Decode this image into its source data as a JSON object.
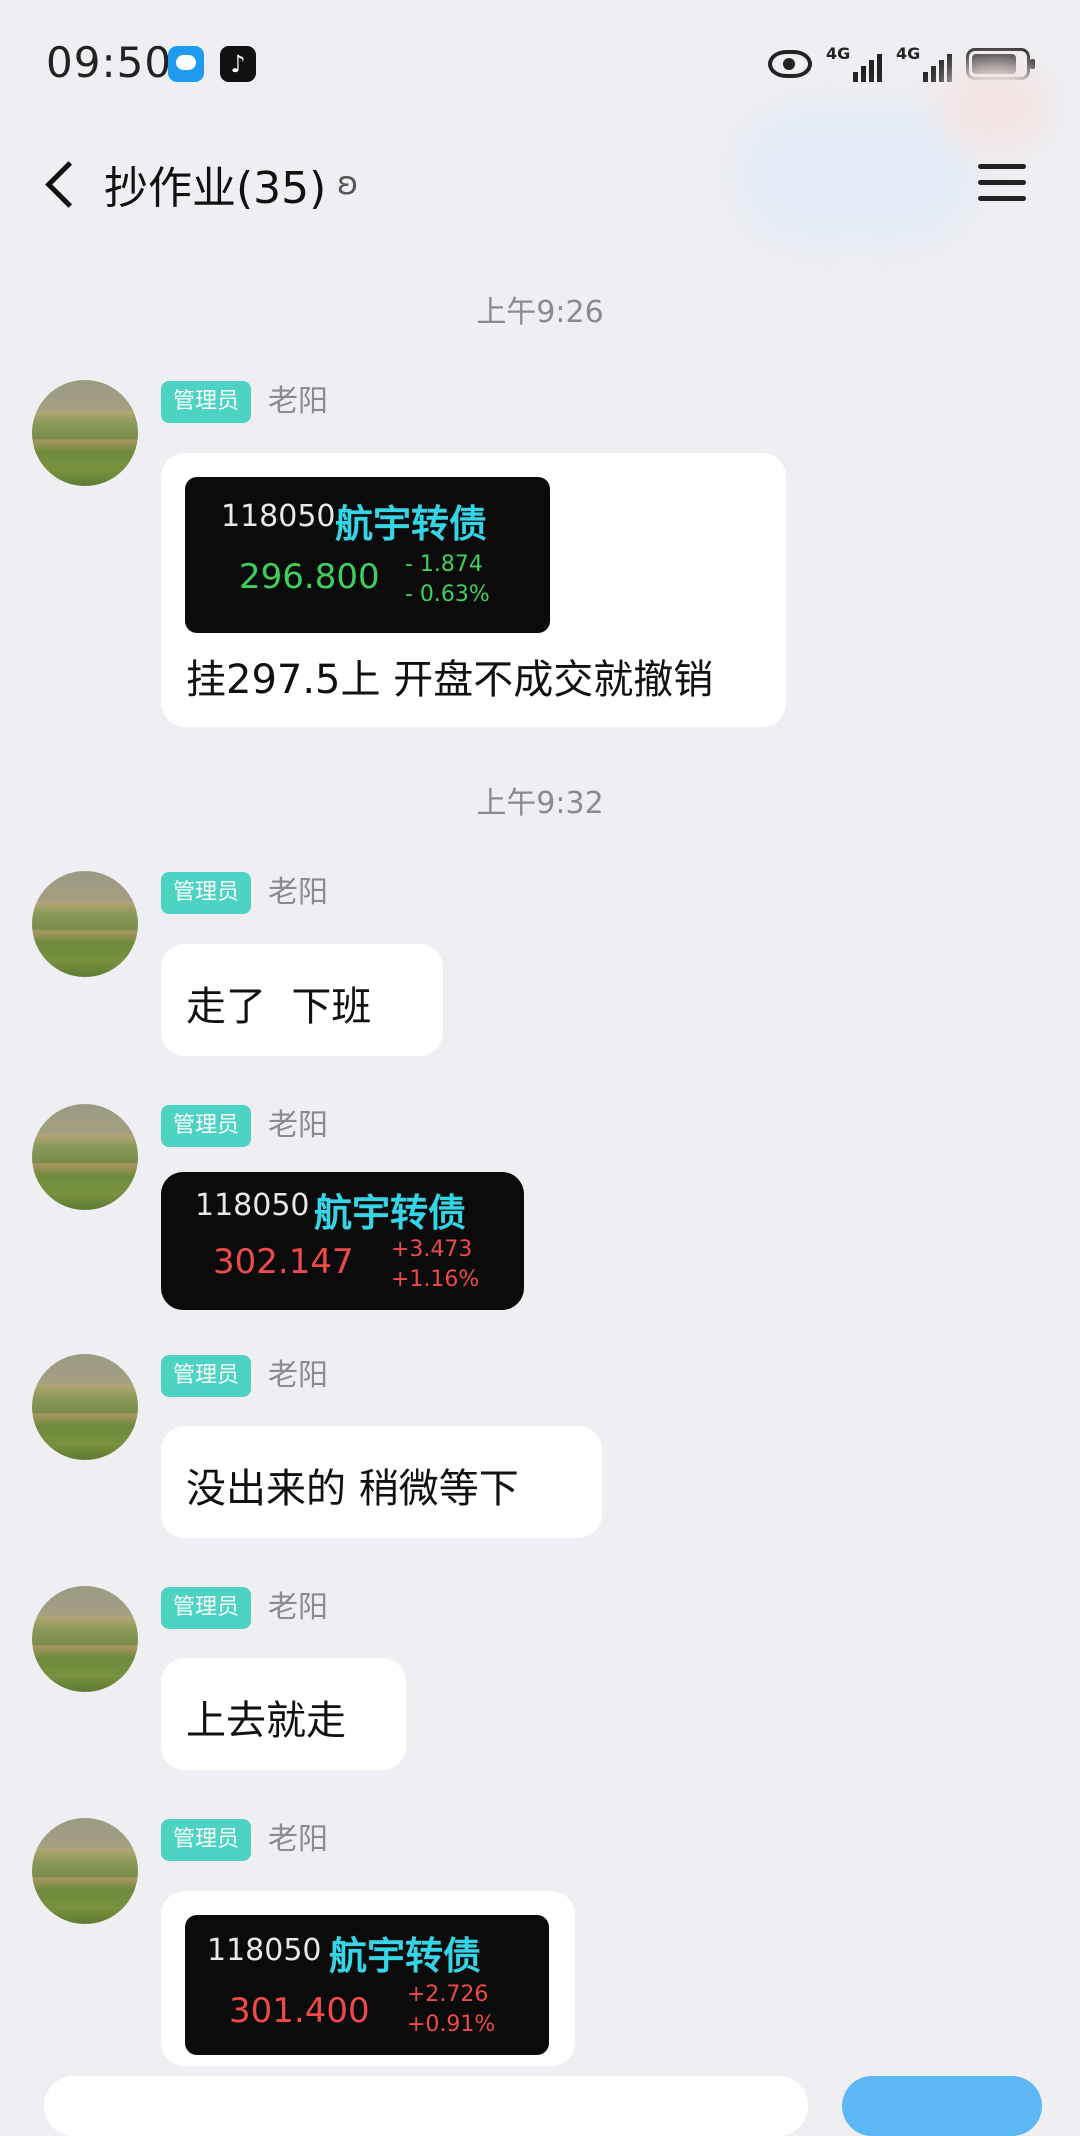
{
  "status_bar": {
    "time": "09:50",
    "net1": "4G",
    "net2": "4G"
  },
  "header": {
    "title": "抄作业(35)"
  },
  "timestamps": [
    "上午9:26",
    "上午9:32"
  ],
  "messages": [
    {
      "badge": "管理员",
      "sender": "老阳",
      "quote": {
        "code": "118050",
        "name": "航宇转债",
        "price": "296.800",
        "change": "- 1.874",
        "pct": "- 0.63%"
      },
      "text": "挂297.5上 开盘不成交就撤销"
    },
    {
      "badge": "管理员",
      "sender": "老阳",
      "text": "走了  下班"
    },
    {
      "badge": "管理员",
      "sender": "老阳",
      "quote": {
        "code": "118050",
        "name": "航宇转债",
        "price": "302.147",
        "change": "+3.473",
        "pct": "+1.16%"
      }
    },
    {
      "badge": "管理员",
      "sender": "老阳",
      "text": "没出来的 稍微等下"
    },
    {
      "badge": "管理员",
      "sender": "老阳",
      "text": "上去就走"
    },
    {
      "badge": "管理员",
      "sender": "老阳",
      "quote": {
        "code": "118050",
        "name": "航宇转债",
        "price": "301.400",
        "change": "+2.726",
        "pct": "+0.91%"
      }
    }
  ],
  "colors": {
    "badge": "#4dd3c3",
    "up": "#ee4a4a",
    "down": "#3fcf5c",
    "stock_name": "#35d5e6"
  }
}
